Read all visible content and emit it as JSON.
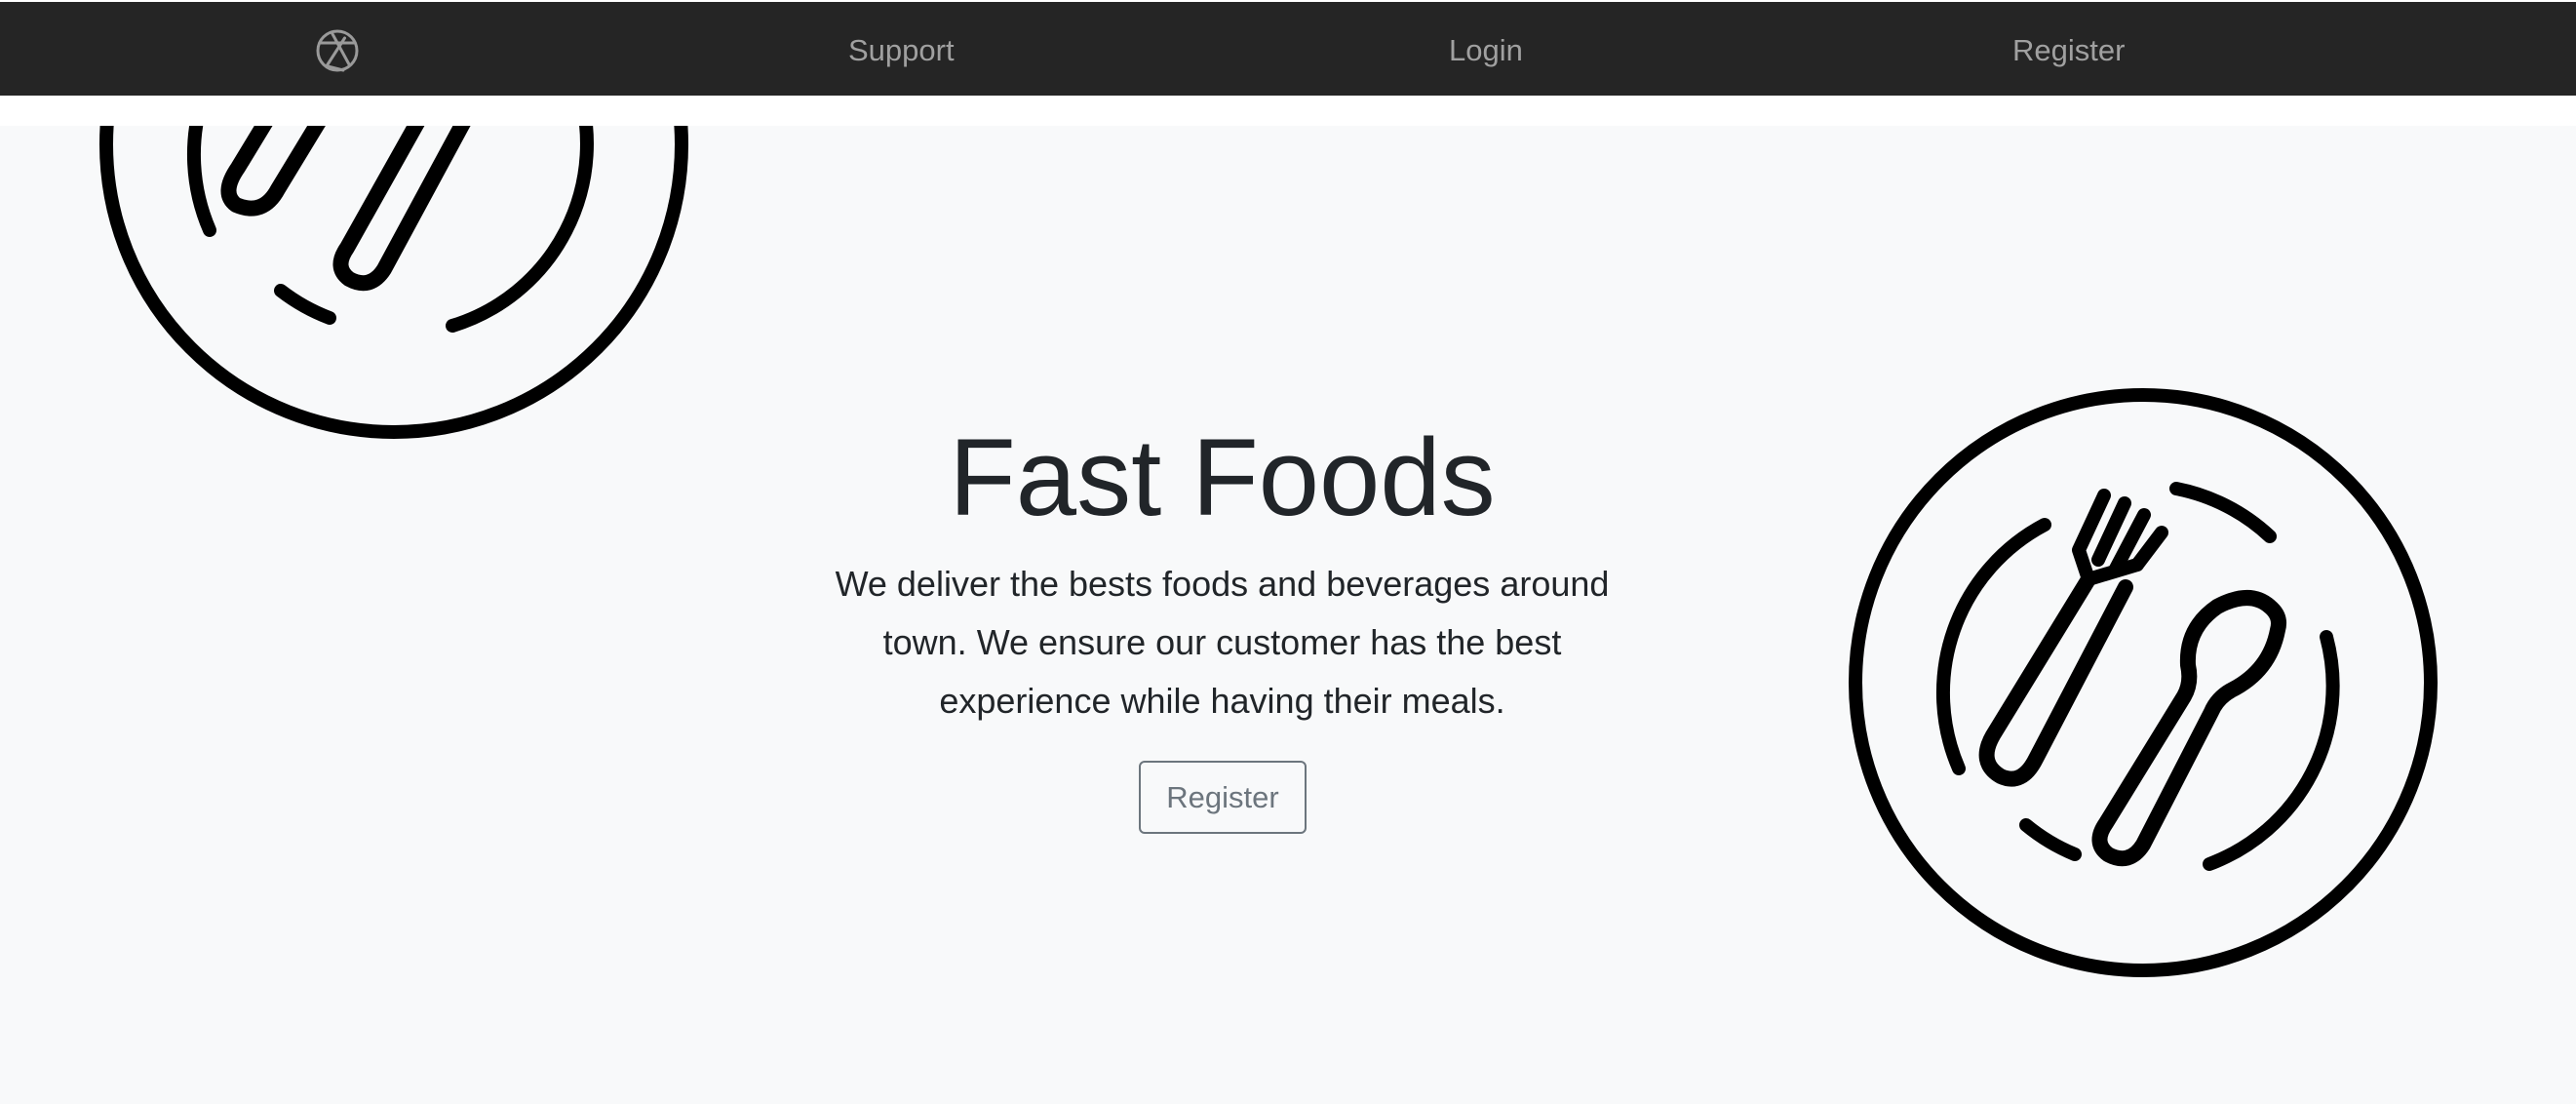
{
  "navbar": {
    "logo_icon": "aperture-icon",
    "links": [
      {
        "label": "Support"
      },
      {
        "label": "Login"
      },
      {
        "label": "Register"
      }
    ],
    "background": "#252525",
    "link_color": "#a0a0a0"
  },
  "hero": {
    "title": "Fast Foods",
    "lead": "We deliver the bests foods and beverages around\ntown. We ensure our customer has the best\nexperience while having their meals.",
    "button_label": "Register",
    "background": "#f8f9fa",
    "decorations": [
      "plate-with-fork-and-spoon-icon",
      "plate-with-fork-and-spoon-icon"
    ]
  }
}
